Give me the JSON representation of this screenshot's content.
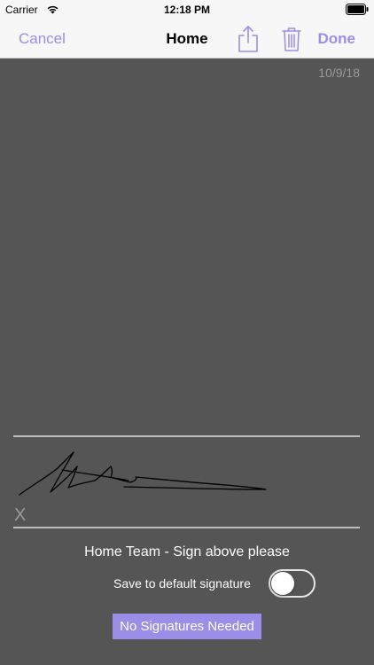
{
  "status_bar": {
    "carrier": "Carrier",
    "time": "12:18 PM",
    "wifi_icon": "wifi-icon",
    "battery_icon": "battery-icon"
  },
  "nav": {
    "cancel_label": "Cancel",
    "title": "Home",
    "share_icon": "share-icon",
    "trash_icon": "trash-icon",
    "done_label": "Done"
  },
  "canvas": {
    "date": "10/9/18",
    "x_mark": "X"
  },
  "footer": {
    "prompt": "Home Team - Sign above please",
    "save_default_label": "Save to default signature",
    "save_default_on": false,
    "no_signatures_button": "No Signatures Needed"
  },
  "colors": {
    "accent": "#9b8ee8",
    "background": "#555555",
    "bar": "#f7f7f7"
  }
}
